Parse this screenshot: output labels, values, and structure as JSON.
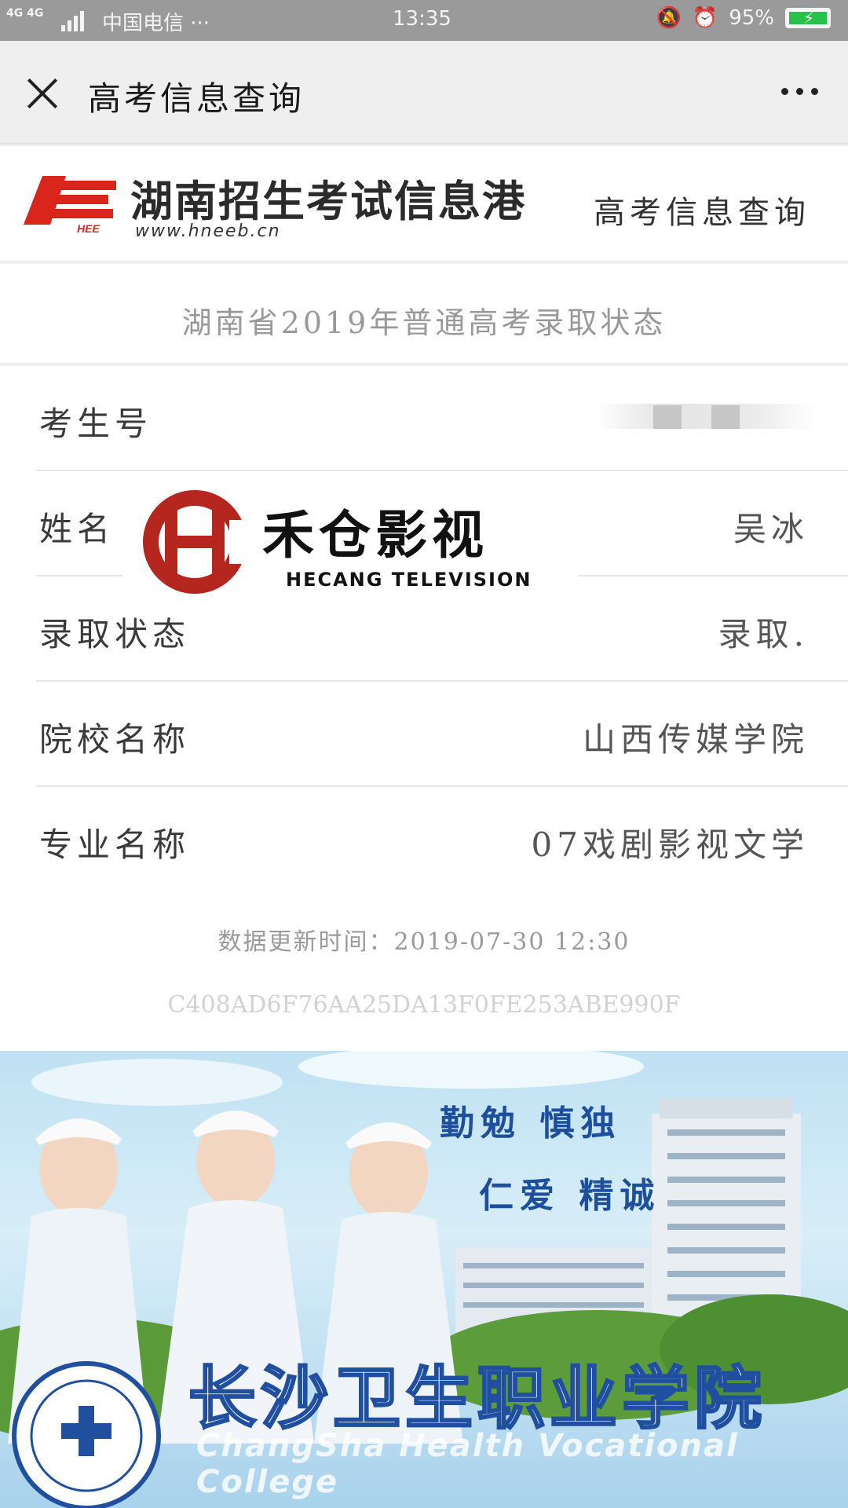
{
  "status_bar": {
    "network": "4G 4G",
    "carrier": "中国电信 ···",
    "time": "13:35",
    "battery": "95%"
  },
  "nav": {
    "title": "高考信息查询"
  },
  "site": {
    "name": "湖南招生考试信息港",
    "url": "www.hneeb.cn",
    "logo_text": "HEE",
    "query_label": "高考信息查询"
  },
  "page": {
    "subtitle": "湖南省2019年普通高考录取状态"
  },
  "fields": [
    {
      "label": "考生号",
      "value": ""
    },
    {
      "label": "姓名",
      "value": "吴冰"
    },
    {
      "label": "录取状态",
      "value": "录取."
    },
    {
      "label": "院校名称",
      "value": "山西传媒学院"
    },
    {
      "label": "专业名称",
      "value": "07戏剧影视文学"
    }
  ],
  "watermark": {
    "cn": "禾仓影视",
    "en": "HECANG TELEVISION"
  },
  "meta": {
    "updated": "数据更新时间：2019-07-30 12:30",
    "hash": "C408AD6F76AA25DA13F0FE253ABE990F"
  },
  "banner": {
    "motto_1": "勤勉 慎独",
    "motto_2": "仁爱 精诚",
    "college_cn": "长沙卫生职业学院",
    "college_en": "ChangSha Health Vocational College"
  },
  "colors": {
    "logo_red": "#d9251c",
    "watermark_red": "#b5261e",
    "banner_blue": "#1f4f9e"
  }
}
